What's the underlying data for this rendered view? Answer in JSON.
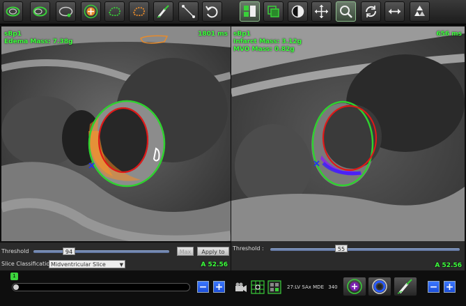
{
  "left_view": {
    "series": "sBp1",
    "measure": "Edema Mass: 7.38g",
    "time": "1801 ms",
    "threshold_label": "Threshold",
    "threshold_value": "94",
    "max_label": "Max",
    "apply_label": "Apply to all",
    "slice_class_label": "Slice Classification",
    "slice_class_value": "Midventricular Slice",
    "angle": "A 52.56"
  },
  "right_view": {
    "series": "sBp1",
    "measure1": "Infarct Mass: 3.12g",
    "measure2": "MVO Mass: 0.82g",
    "time": "656 ms",
    "threshold_label": "Threshold :",
    "threshold_value": "55",
    "angle": "A 52.56"
  },
  "timeline": {
    "marker": "1",
    "minus": "−",
    "plus": "+"
  },
  "series_info": {
    "label": "27:LV SAx MDE",
    "number": "340"
  },
  "colors": {
    "overlay_text": "#3cff3c",
    "epicardium": "#2fd12f",
    "endocardium": "#e01818",
    "edema": "#ff9a2a",
    "infarct": "#8a2be2"
  }
}
